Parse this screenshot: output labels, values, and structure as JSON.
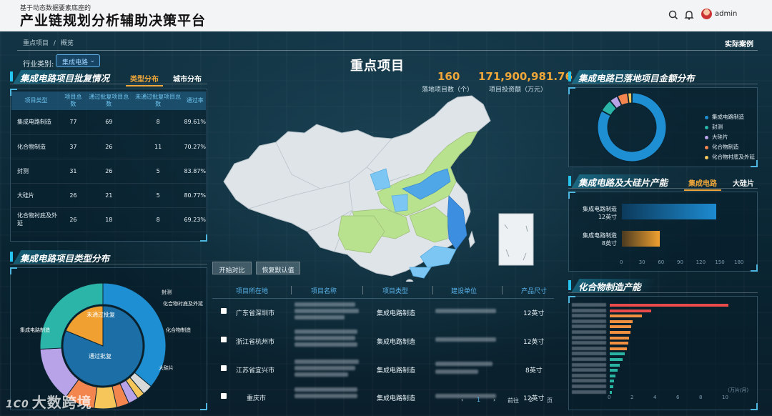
{
  "header": {
    "subtitle": "基于动态数据要素底座的",
    "title": "产业链规划分析辅助决策平台",
    "user": "admin"
  },
  "breadcrumb": {
    "root": "重点项目",
    "sep": "/",
    "current": "概览"
  },
  "case_link": "实际案例",
  "filter": {
    "label": "行业类别:",
    "value": "集成电路"
  },
  "page_title": "重点项目",
  "kpis": [
    {
      "value": "160",
      "label": "落地项目数（个）"
    },
    {
      "value": "171,900,981.76",
      "label": "项目投资额（万元）"
    }
  ],
  "approval": {
    "title": "集成电路项目批复情况",
    "tabs": [
      "类型分布",
      "城市分布"
    ],
    "columns": [
      "项目类型",
      "项目总数",
      "通过批复项目总数",
      "未通过批复项目总数",
      "通过率"
    ],
    "rows": [
      {
        "type": "集成电路制造",
        "total": "77",
        "passed": "69",
        "failed": "8",
        "rate": "89.61%"
      },
      {
        "type": "化合物制造",
        "total": "37",
        "passed": "26",
        "failed": "11",
        "rate": "70.27%"
      },
      {
        "type": "封测",
        "total": "31",
        "passed": "26",
        "failed": "5",
        "rate": "83.87%"
      },
      {
        "type": "大硅片",
        "total": "26",
        "passed": "21",
        "failed": "5",
        "rate": "80.77%"
      },
      {
        "type": "化合物衬底及外延",
        "total": "26",
        "passed": "18",
        "failed": "8",
        "rate": "69.23%"
      }
    ]
  },
  "type_dist": {
    "title": "集成电路项目类型分布",
    "inner_labels": [
      "未通过批复",
      "通过批复"
    ],
    "outer_labels": [
      "集成电路制造",
      "化合物制造",
      "大硅片",
      "化合物衬底及外延",
      "封测"
    ]
  },
  "buttons": {
    "compare": "开始对比",
    "reset": "恢复默认值"
  },
  "projects": {
    "columns": [
      "项目所在地",
      "项目名称",
      "项目类型",
      "建设单位",
      "产品尺寸"
    ],
    "rows": [
      {
        "location": "广东省深圳市",
        "type": "集成电路制造",
        "size": "12英寸"
      },
      {
        "location": "浙江省杭州市",
        "type": "集成电路制造",
        "size": "12英寸"
      },
      {
        "location": "江苏省宜兴市",
        "type": "集成电路制造",
        "size": "8英寸"
      },
      {
        "location": "重庆市",
        "type": "集成电路制造",
        "size": "12英寸"
      }
    ],
    "pager": {
      "prev": "‹",
      "page": "1",
      "next": "›",
      "goto": "前往",
      "input": "2",
      "unit": "页"
    }
  },
  "landed": {
    "title": "集成电路已落地项目金额分布",
    "legend": [
      {
        "name": "集成电路制造",
        "color": "#1f8fd4"
      },
      {
        "name": "封测",
        "color": "#2bb5a8"
      },
      {
        "name": "大硅片",
        "color": "#b9a3e8"
      },
      {
        "name": "化合物制造",
        "color": "#f3854f"
      },
      {
        "name": "化合物衬底及外延",
        "color": "#f6c65a"
      }
    ]
  },
  "capacity": {
    "title": "集成电路及大硅片产能",
    "tabs": [
      "集成电路",
      "大硅片"
    ],
    "bars": [
      {
        "label1": "集成电路制造",
        "label2": "12英寸"
      },
      {
        "label1": "集成电路制造",
        "label2": "8英寸"
      }
    ],
    "ticks": [
      "0",
      "30",
      "60",
      "90",
      "120",
      "150",
      "180"
    ]
  },
  "compound": {
    "title": "化合物制造产能",
    "ticks": [
      "0",
      "2",
      "4",
      "6",
      "8",
      "10"
    ],
    "unit": "（万片/月）"
  },
  "chart_data": [
    {
      "type": "pie",
      "title": "集成电路已落地项目金额分布",
      "categories": [
        "集成电路制造",
        "封测",
        "大硅片",
        "化合物制造",
        "化合物衬底及外延"
      ],
      "values": [
        83,
        6,
        4,
        5,
        2
      ]
    },
    {
      "type": "bar",
      "title": "集成电路及大硅片产能",
      "categories": [
        "集成电路制造 12英寸",
        "集成电路制造 8英寸"
      ],
      "values": [
        148,
        60
      ],
      "xlim": [
        0,
        180
      ]
    },
    {
      "type": "pie",
      "title": "集成电路项目类型分布",
      "inner": {
        "categories": [
          "通过批复",
          "未通过批复"
        ],
        "values": [
          160,
          37
        ]
      },
      "outer": {
        "categories": [
          "集成电路制造",
          "化合物制造",
          "大硅片",
          "化合物衬底及外延",
          "封测",
          "其他"
        ],
        "values": [
          77,
          37,
          26,
          26,
          31,
          0
        ]
      }
    },
    {
      "type": "bar",
      "title": "化合物制造产能",
      "values": [
        10.4,
        3.6,
        2.8,
        2.0,
        1.9,
        1.8,
        1.7,
        1.6,
        1.5,
        1.3,
        1.1,
        0.9,
        0.7,
        0.5,
        0.4,
        0.3,
        0.2
      ],
      "xlim": [
        0,
        10
      ]
    }
  ]
}
